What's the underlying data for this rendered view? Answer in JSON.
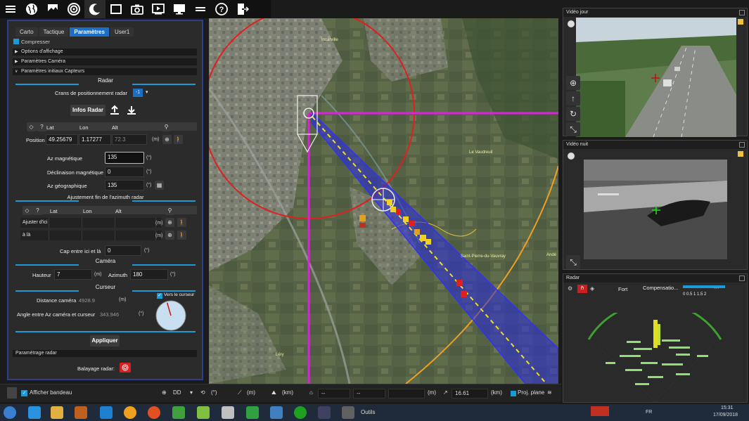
{
  "toolbar": {
    "icons": [
      "menu-icon",
      "globe-icon",
      "terrain-icon",
      "radar-icon",
      "moon-icon",
      "map-frame-icon",
      "camera-icon",
      "play-icon",
      "monitor-icon",
      "menu-icon",
      "help-icon",
      "exit-icon"
    ]
  },
  "left_panel": {
    "tabs": [
      {
        "label": "Carto",
        "active": false
      },
      {
        "label": "Tactique",
        "active": false
      },
      {
        "label": "Paramètres",
        "active": true
      },
      {
        "label": "User1",
        "active": false
      }
    ],
    "compress_label": "Compresser",
    "sections": [
      "Options d'affichage",
      "Paramètres Caméra",
      "Paramètres initiaux Capteurs"
    ],
    "radar": {
      "title": "Radar",
      "crans_label": "Crans de positionnement radar",
      "crans_value": "-1",
      "infos_button": "Infos Radar",
      "col_lat": "Lat",
      "col_lon": "Lon",
      "col_alt": "Alt",
      "position_label": "Position",
      "lat": "49.25679",
      "lon": "1.17277",
      "alt": "72.3",
      "alt_unit": "(m)",
      "az_mag_label": "Az magnétique",
      "az_mag": "135",
      "decl_label": "Déclinaison magnétique",
      "decl": "0",
      "az_geo_label": "Az géographique",
      "az_geo": "135",
      "deg_unit": "(°)"
    },
    "azimuth": {
      "title": "Ajustement fin de l'azimuth radar",
      "col_lat": "Lat",
      "col_lon": "Lon",
      "col_alt": "Alt",
      "row1": "Ajuster d'ici",
      "row2": "à là",
      "unit": "(m)",
      "cap_label": "Cap entre ici et là",
      "cap": "0",
      "cap_unit": "(°)"
    },
    "camera": {
      "title": "Caméra",
      "hauteur_label": "Hauteur",
      "hauteur": "7",
      "hauteur_unit": "(m)",
      "azimuth_label": "Azimuth",
      "azimuth": "180",
      "azimuth_unit": "(°)"
    },
    "curseur": {
      "title": "Curseur",
      "vers_label": "Vers le curseur",
      "dist_label": "Distance caméra",
      "dist": "4928.9",
      "dist_unit": "(m)",
      "angle_label": "Angle entre Az caméra et curseur",
      "angle": "343.946",
      "angle_unit": "(°)",
      "compass_angle_deg": 343.946
    },
    "apply_button": "Appliquer",
    "param_radar": "Paramétrage radar",
    "balayage_label": "Balayage radar:"
  },
  "map": {
    "labels": [
      "Le Vaudreuil",
      "Saint-Pierre-du-Vauvray",
      "Andé",
      "Léry",
      "Incarville"
    ]
  },
  "right": {
    "video_day_title": "Vidéo jour",
    "video_night_title": "Vidéo nuit",
    "radar_title": "Radar",
    "radar_mode": "Fort",
    "radar_comp": "Compensatio...",
    "radar_scale": "0  0.5  1  1.5  2"
  },
  "statusbar": {
    "afficher_bandeau": "Afficher bandeau",
    "dd": "DD",
    "deg_unit": "(°)",
    "m_unit": "(m)",
    "km_unit": "(km)",
    "dash1": "--",
    "dash2": "--",
    "m_unit2": "(m)",
    "distance": "16.61",
    "km_unit2": "(km)",
    "proj": "Proj. plane"
  },
  "taskbar": {
    "outils": "Outils",
    "lang": "FR",
    "time": "15:31",
    "date": "17/09/2018"
  },
  "colors": {
    "accent": "#1b6fc6",
    "section_line": "#1b9ad6",
    "panel_border": "#2c3e8e",
    "beam": "#2a2ae0",
    "range_circle": "#e02020",
    "magenta": "#e020e0"
  }
}
